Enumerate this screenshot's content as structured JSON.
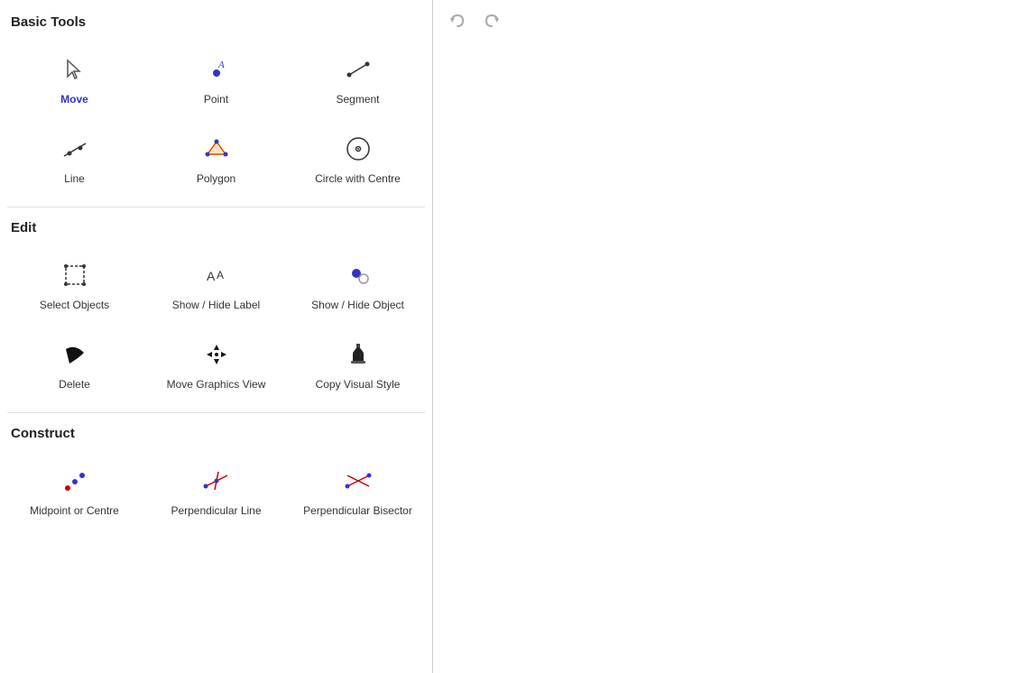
{
  "toolbar": {
    "undo_label": "Undo",
    "redo_label": "Redo"
  },
  "sections": [
    {
      "id": "basic-tools",
      "title": "Basic Tools",
      "tools": [
        {
          "id": "move",
          "label": "Move",
          "active": true
        },
        {
          "id": "point",
          "label": "Point",
          "active": false
        },
        {
          "id": "segment",
          "label": "Segment",
          "active": false
        },
        {
          "id": "line",
          "label": "Line",
          "active": false
        },
        {
          "id": "polygon",
          "label": "Polygon",
          "active": false
        },
        {
          "id": "circle-with-centre",
          "label": "Circle with Centre",
          "active": false
        }
      ]
    },
    {
      "id": "edit",
      "title": "Edit",
      "tools": [
        {
          "id": "select-objects",
          "label": "Select Objects",
          "active": false
        },
        {
          "id": "show-hide-label",
          "label": "Show / Hide Label",
          "active": false
        },
        {
          "id": "show-hide-object",
          "label": "Show / Hide Object",
          "active": false
        },
        {
          "id": "delete",
          "label": "Delete",
          "active": false
        },
        {
          "id": "move-graphics-view",
          "label": "Move Graphics View",
          "active": false
        },
        {
          "id": "copy-visual-style",
          "label": "Copy Visual Style",
          "active": false
        }
      ]
    },
    {
      "id": "construct",
      "title": "Construct",
      "tools": [
        {
          "id": "midpoint-or-centre",
          "label": "Midpoint or Centre",
          "active": false
        },
        {
          "id": "perpendicular-line",
          "label": "Perpendicular Line",
          "active": false
        },
        {
          "id": "perpendicular-bisector",
          "label": "Perpendicular Bisector",
          "active": false
        }
      ]
    }
  ]
}
